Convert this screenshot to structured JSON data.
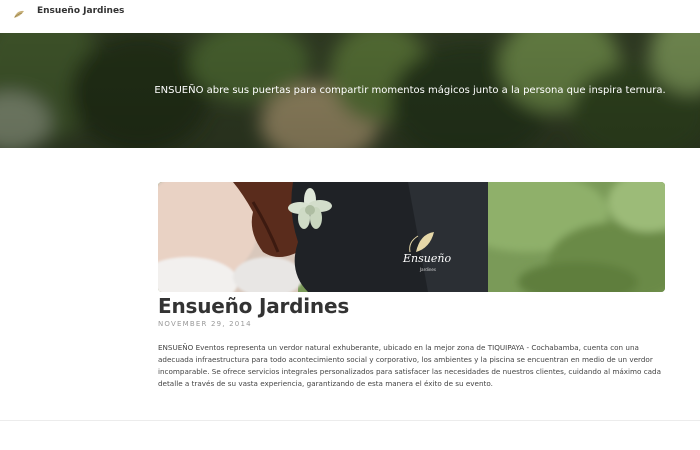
{
  "header": {
    "site_title": "Ensueño Jardines",
    "logo_icon": "leaf-logo-icon"
  },
  "hero": {
    "tagline": "ENSUEÑO abre sus puertas para compartir momentos mágicos junto a la persona que inspira ternura."
  },
  "post": {
    "title": "Ensueño Jardines",
    "date": "NOVEMBER 29, 2014",
    "body": "ENSUEÑO Eventos representa un verdor natural exhuberante, ubicado en la mejor zona de TIQUIPAYA - Cochabamba, cuenta con una adecuada infraestructura para todo acontecimiento social y corporativo, los ambientes y la piscina se encuentran en medio de un verdor incomparable. Se ofrece servicios integrales personalizados para satisfacer las necesidades de nuestros clientes, cuidando al máximo cada detalle a través de su vasta experiencia, garantizando de esta manera el éxito de su evento.",
    "image_logo_text": "Ensueño",
    "image_logo_subtext": "Jardines"
  }
}
